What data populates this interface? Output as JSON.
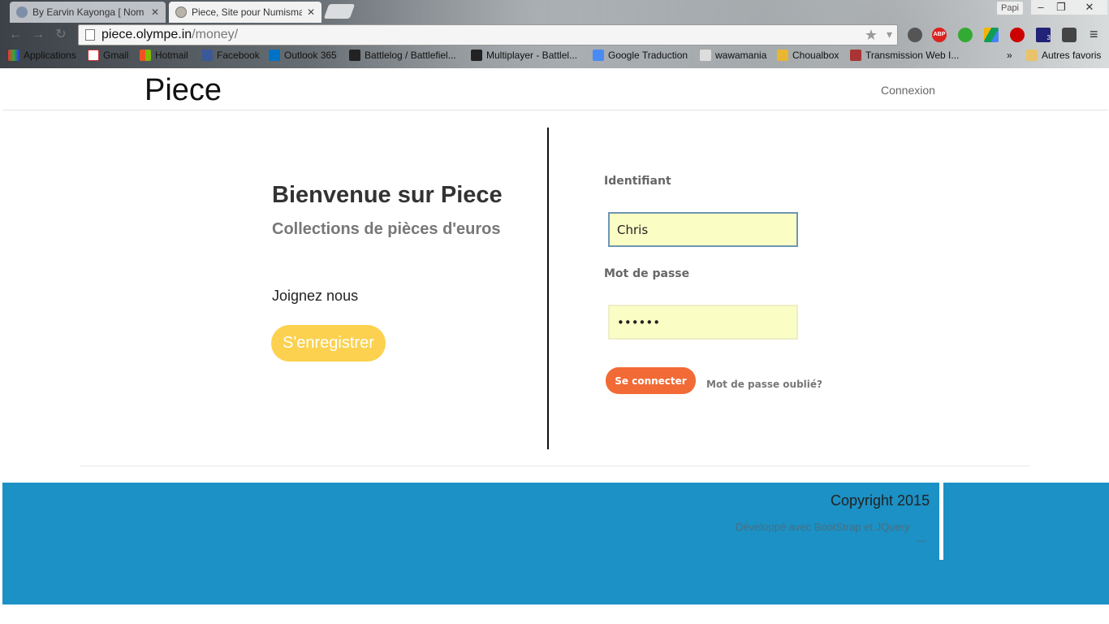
{
  "browser": {
    "tabs": [
      {
        "title": "By Earvin Kayonga [ Nom",
        "active": false
      },
      {
        "title": "Piece, Site pour Numisma",
        "active": true
      }
    ],
    "profile": "Papi",
    "url_host": "piece.olympe.in",
    "url_path": "/money/",
    "bookmarks": [
      "Applications",
      "Gmail",
      "Hotmail",
      "Facebook",
      "Outlook 365",
      "Battlelog / Battlefiel...",
      "Multiplayer - Battlel...",
      "Google Traduction",
      "wawamania",
      "Choualbox",
      "Transmission Web I..."
    ],
    "bookmarks_overflow": "»",
    "other_bookmarks": "Autres favoris",
    "extensions_badge": "3",
    "adblock_label": "ABP"
  },
  "site": {
    "brand": "Piece",
    "nav_login": "Connexion"
  },
  "welcome": {
    "title": "Bienvenue sur Piece",
    "subtitle": "Collections de pièces d'euros",
    "join": "Joignez nous",
    "register_label": "S'enregistrer"
  },
  "login": {
    "username_label": "Identifiant",
    "username_value": "Chris",
    "password_label": "Mot de passe",
    "password_value": "••••••",
    "submit_label": "Se connecter",
    "forgot_label": "Mot de passe oublié?"
  },
  "footer": {
    "copyright": "Copyright 2015",
    "developed": "Développé avec BootStrap et JQuery",
    "dash": "—"
  },
  "colors": {
    "footer_bg": "#1b91c5",
    "register_btn": "#fbd14f",
    "login_btn": "#f26a35",
    "input_bg": "#fafdc4"
  }
}
